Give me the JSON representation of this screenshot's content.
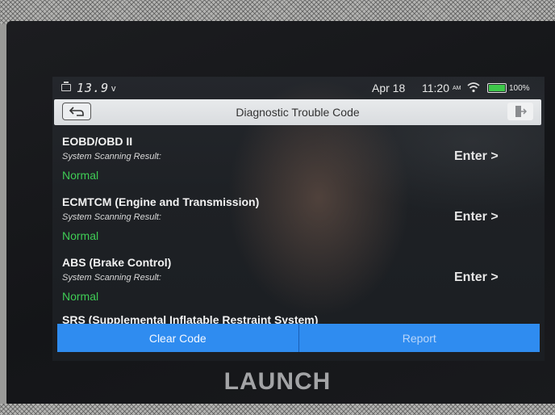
{
  "device": {
    "brand": "LAUNCH"
  },
  "status_bar": {
    "voltage": "13.9",
    "voltage_unit": "v",
    "date": "Apr 18",
    "time": "11:20",
    "ampm": "AM",
    "battery": "100%",
    "battery_color": "#3ec84a"
  },
  "header": {
    "title": "Diagnostic Trouble Code",
    "back_icon": "back-arrow-icon",
    "exit_icon": "exit-icon"
  },
  "systems": [
    {
      "name": "EOBD/OBD II",
      "scan_label": "System Scanning Result:",
      "result": "Normal",
      "action": "Enter >"
    },
    {
      "name": "ECMTCM (Engine and Transmission)",
      "scan_label": "System Scanning Result:",
      "result": "Normal",
      "action": "Enter >"
    },
    {
      "name": "ABS (Brake Control)",
      "scan_label": "System Scanning Result:",
      "result": "Normal",
      "action": "Enter >"
    },
    {
      "name": "SRS (Supplemental Inflatable Restraint System)"
    }
  ],
  "actions": {
    "clear_code": "Clear Code",
    "report": "Report"
  },
  "colors": {
    "accent": "#2f8cf0",
    "normal": "#3fcc55"
  }
}
